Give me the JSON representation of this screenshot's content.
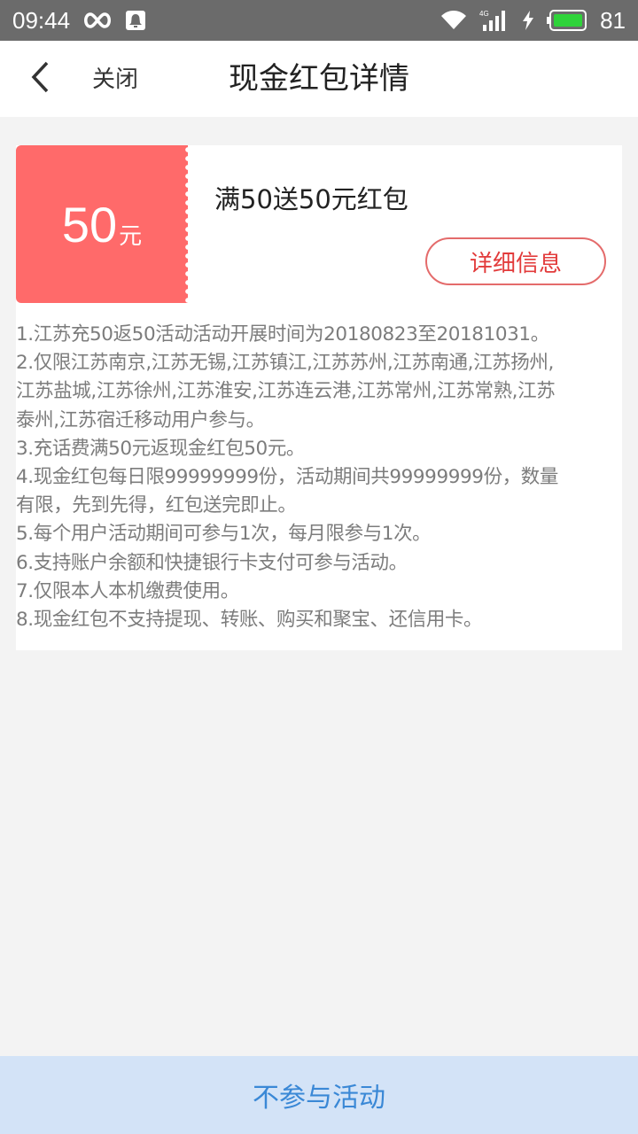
{
  "status_bar": {
    "time": "09:44",
    "battery_level": "81",
    "icons": [
      "infinity-icon",
      "notification-icon",
      "wifi-icon",
      "signal-4g-icon",
      "charging-icon",
      "battery-icon"
    ],
    "battery_color": "#2fd33a"
  },
  "header": {
    "back_icon": "chevron-left-icon",
    "close_label": "关闭",
    "title": "现金红包详情"
  },
  "coupon": {
    "amount": "50",
    "unit": "元",
    "title": "满50送50元红包",
    "detail_button": "详细信息",
    "color": "#ff6a6a"
  },
  "rules": [
    "1.江苏充50返50活动活动开展时间为20180823至20181031。",
    "2.仅限江苏南京,江苏无锡,江苏镇江,江苏苏州,江苏南通,江苏扬州,",
    "江苏盐城,江苏徐州,江苏淮安,江苏连云港,江苏常州,江苏常熟,江苏",
    "泰州,江苏宿迁移动用户参与。",
    "3.充话费满50元返现金红包50元。",
    "4.现金红包每日限99999999份，活动期间共99999999份，数量",
    "有限，先到先得，红包送完即止。",
    "5.每个用户活动期间可参与1次，每月限参与1次。",
    "6.支持账户余额和快捷银行卡支付可参与活动。",
    "7.仅限本人本机缴费使用。",
    "8.现金红包不支持提现、转账、购买和聚宝、还信用卡。"
  ],
  "bottom": {
    "label": "不参与活动"
  }
}
